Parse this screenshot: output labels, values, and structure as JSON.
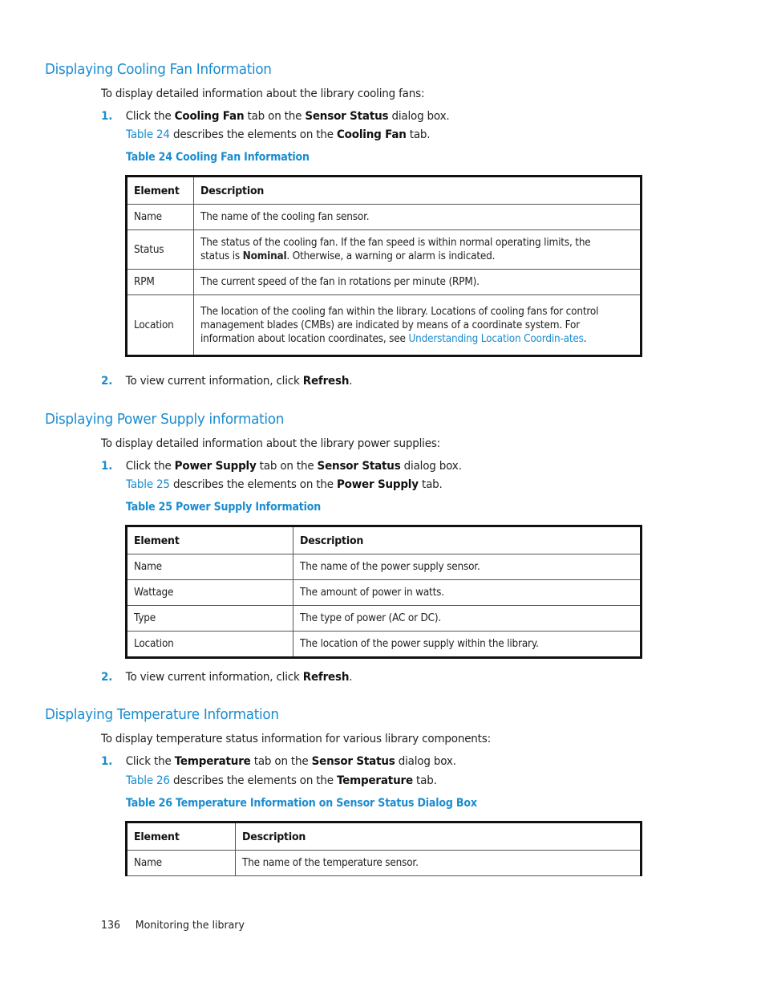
{
  "accent_color": "#1a8ccf",
  "sections": [
    {
      "heading": "Displaying Cooling Fan Information",
      "intro": "To display detailed information about the library cooling fans:",
      "step1": {
        "num": "1.",
        "pre": "Click the ",
        "b1": "Cooling Fan",
        "mid": " tab on the ",
        "b2": "Sensor Status",
        "post": " dialog box."
      },
      "ref": {
        "link": "Table 24",
        "pre": " describes the elements on the ",
        "b": "Cooling Fan",
        "post": " tab."
      },
      "caption": "Table 24 Cooling Fan Information",
      "table": {
        "headers": [
          "Element",
          "Description"
        ],
        "rows": [
          {
            "element": "Name",
            "description": "The name of the cooling fan sensor."
          },
          {
            "element": "Status",
            "description_pre": "The status of the cooling fan. If the fan speed is within normal operating limits, the status is ",
            "description_bold": "Nominal",
            "description_post": ". Otherwise, a warning or alarm is indicated."
          },
          {
            "element": "RPM",
            "description": "The current speed of the fan in rotations per minute (RPM)."
          },
          {
            "element": "Location",
            "description_pre": "The location of the cooling fan within the library. Locations of cooling fans for control management blades (CMBs) are indicated by means of a coordinate system. For information about location coordinates, see ",
            "description_link": "Understanding Location Coordin-ates",
            "description_post": "."
          }
        ]
      },
      "step2": {
        "num": "2.",
        "pre": "To view current information, click ",
        "b": "Refresh",
        "post": "."
      }
    },
    {
      "heading": "Displaying Power Supply information",
      "intro": "To display detailed information about the library power supplies:",
      "step1": {
        "num": "1.",
        "pre": "Click the ",
        "b1": "Power Supply",
        "mid": " tab on the ",
        "b2": "Sensor Status",
        "post": " dialog box."
      },
      "ref": {
        "link": "Table 25",
        "pre": " describes the elements on the ",
        "b": "Power Supply",
        "post": " tab."
      },
      "caption": "Table 25 Power Supply Information",
      "table": {
        "headers": [
          "Element",
          "Description"
        ],
        "rows": [
          {
            "element": "Name",
            "description": "The name of the power supply sensor."
          },
          {
            "element": "Wattage",
            "description": "The amount of power in watts."
          },
          {
            "element": "Type",
            "description": "The type of power (AC or DC)."
          },
          {
            "element": "Location",
            "description": "The location of the power supply within the library."
          }
        ]
      },
      "step2": {
        "num": "2.",
        "pre": "To view current information, click ",
        "b": "Refresh",
        "post": "."
      }
    },
    {
      "heading": "Displaying Temperature Information",
      "intro": "To display temperature status information for various library components:",
      "step1": {
        "num": "1.",
        "pre": "Click the ",
        "b1": "Temperature",
        "mid": " tab on the ",
        "b2": "Sensor Status",
        "post": " dialog box."
      },
      "ref": {
        "link": "Table 26",
        "pre": " describes the elements on the ",
        "b": "Temperature",
        "post": " tab."
      },
      "caption": "Table 26 Temperature Information on Sensor Status Dialog Box",
      "table": {
        "headers": [
          "Element",
          "Description"
        ],
        "rows": [
          {
            "element": "Name",
            "description": "The name of the temperature sensor."
          }
        ]
      }
    }
  ],
  "footer": {
    "page_number": "136",
    "chapter": "Monitoring the library"
  }
}
